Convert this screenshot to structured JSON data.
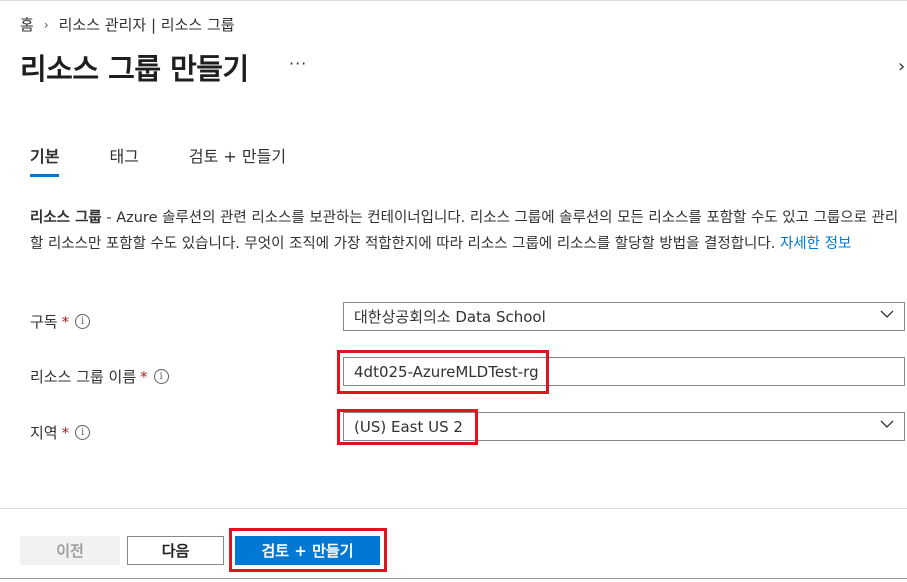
{
  "breadcrumb": {
    "home": "홈",
    "parent": "리소스 관리자 | 리소스 그룹"
  },
  "page": {
    "title": "리소스 그룹 만들기",
    "more": "···"
  },
  "tabs": [
    {
      "label": "기본"
    },
    {
      "label": "태그"
    },
    {
      "label": "검토 + 만들기"
    }
  ],
  "description": {
    "term": "리소스 그룹",
    "text": " - Azure 솔루션의 관련 리소스를 보관하는 컨테이너입니다. 리소스 그룹에 솔루션의 모든 리소스를 포함할 수도 있고 그룹으로 관리할 리소스만 포함할 수도 있습니다. 무엇이 조직에 가장 적합한지에 따라 리소스 그룹에 리소스를 할당할 방법을 결정합니다. ",
    "link": "자세한 정보"
  },
  "form": {
    "subscription": {
      "label": "구독",
      "required": "*",
      "value": "대한상공회의소 Data School"
    },
    "rg_name": {
      "label": "리소스 그룹 이름",
      "required": "*",
      "value": "4dt025-AzureMLDTest-rg"
    },
    "region": {
      "label": "지역",
      "required": "*",
      "value": "(US) East US 2"
    }
  },
  "footer": {
    "prev": "이전",
    "next": "다음",
    "review": "검토 + 만들기"
  },
  "colors": {
    "accent": "#0078d4",
    "highlight": "#e0141e",
    "required": "#a4262c"
  }
}
